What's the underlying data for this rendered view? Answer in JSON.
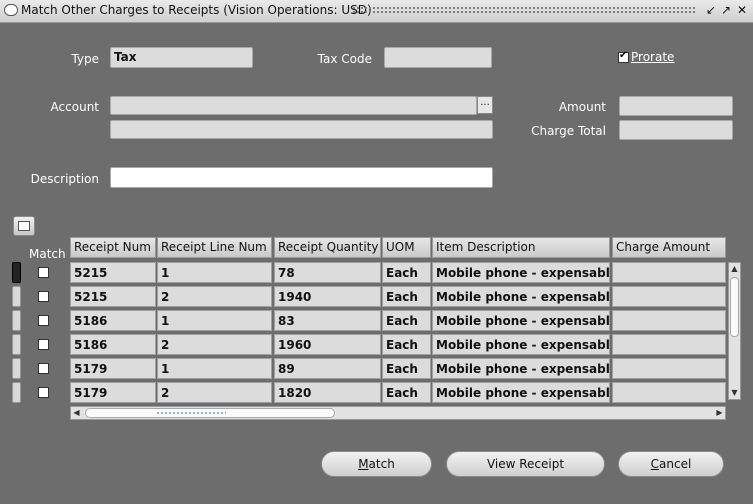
{
  "window": {
    "title": "Match Other Charges to Receipts (Vision Operations: USD)",
    "controls": [
      "restore-icon",
      "maximize-icon",
      "close-icon"
    ]
  },
  "form": {
    "type_label": "Type",
    "type_value": "Tax",
    "tax_code_label": "Tax Code",
    "tax_code_value": "",
    "prorate_label": "Prorate",
    "prorate_checked": true,
    "account_label": "Account",
    "account_value": "",
    "account_lov": "...",
    "amount_label": "Amount",
    "amount_value": "",
    "charge_total_label": "Charge Total",
    "charge_total_value": "",
    "description_label": "Description",
    "description_value": ""
  },
  "table": {
    "match_label": "Match",
    "columns": [
      "Receipt Num",
      "Receipt Line Num",
      "Receipt Quantity",
      "UOM",
      "Item Description",
      "Charge Amount"
    ],
    "rows": [
      {
        "receipt_num": "5215",
        "line_num": "1",
        "quantity": "78",
        "uom": "Each",
        "item": "Mobile phone - expensable",
        "charge": "",
        "matched": false
      },
      {
        "receipt_num": "5215",
        "line_num": "2",
        "quantity": "1940",
        "uom": "Each",
        "item": "Mobile phone - expensable",
        "charge": "",
        "matched": false
      },
      {
        "receipt_num": "5186",
        "line_num": "1",
        "quantity": "83",
        "uom": "Each",
        "item": "Mobile phone - expensable",
        "charge": "",
        "matched": false
      },
      {
        "receipt_num": "5186",
        "line_num": "2",
        "quantity": "1960",
        "uom": "Each",
        "item": "Mobile phone - expensable",
        "charge": "",
        "matched": false
      },
      {
        "receipt_num": "5179",
        "line_num": "1",
        "quantity": "89",
        "uom": "Each",
        "item": "Mobile phone - expensable",
        "charge": "",
        "matched": false
      },
      {
        "receipt_num": "5179",
        "line_num": "2",
        "quantity": "1820",
        "uom": "Each",
        "item": "Mobile phone - expensable",
        "charge": "",
        "matched": false
      }
    ]
  },
  "buttons": {
    "match": {
      "accel": "M",
      "rest": "atch"
    },
    "view_receipt": "View Receipt",
    "cancel": {
      "accel": "C",
      "rest": "ancel"
    }
  }
}
